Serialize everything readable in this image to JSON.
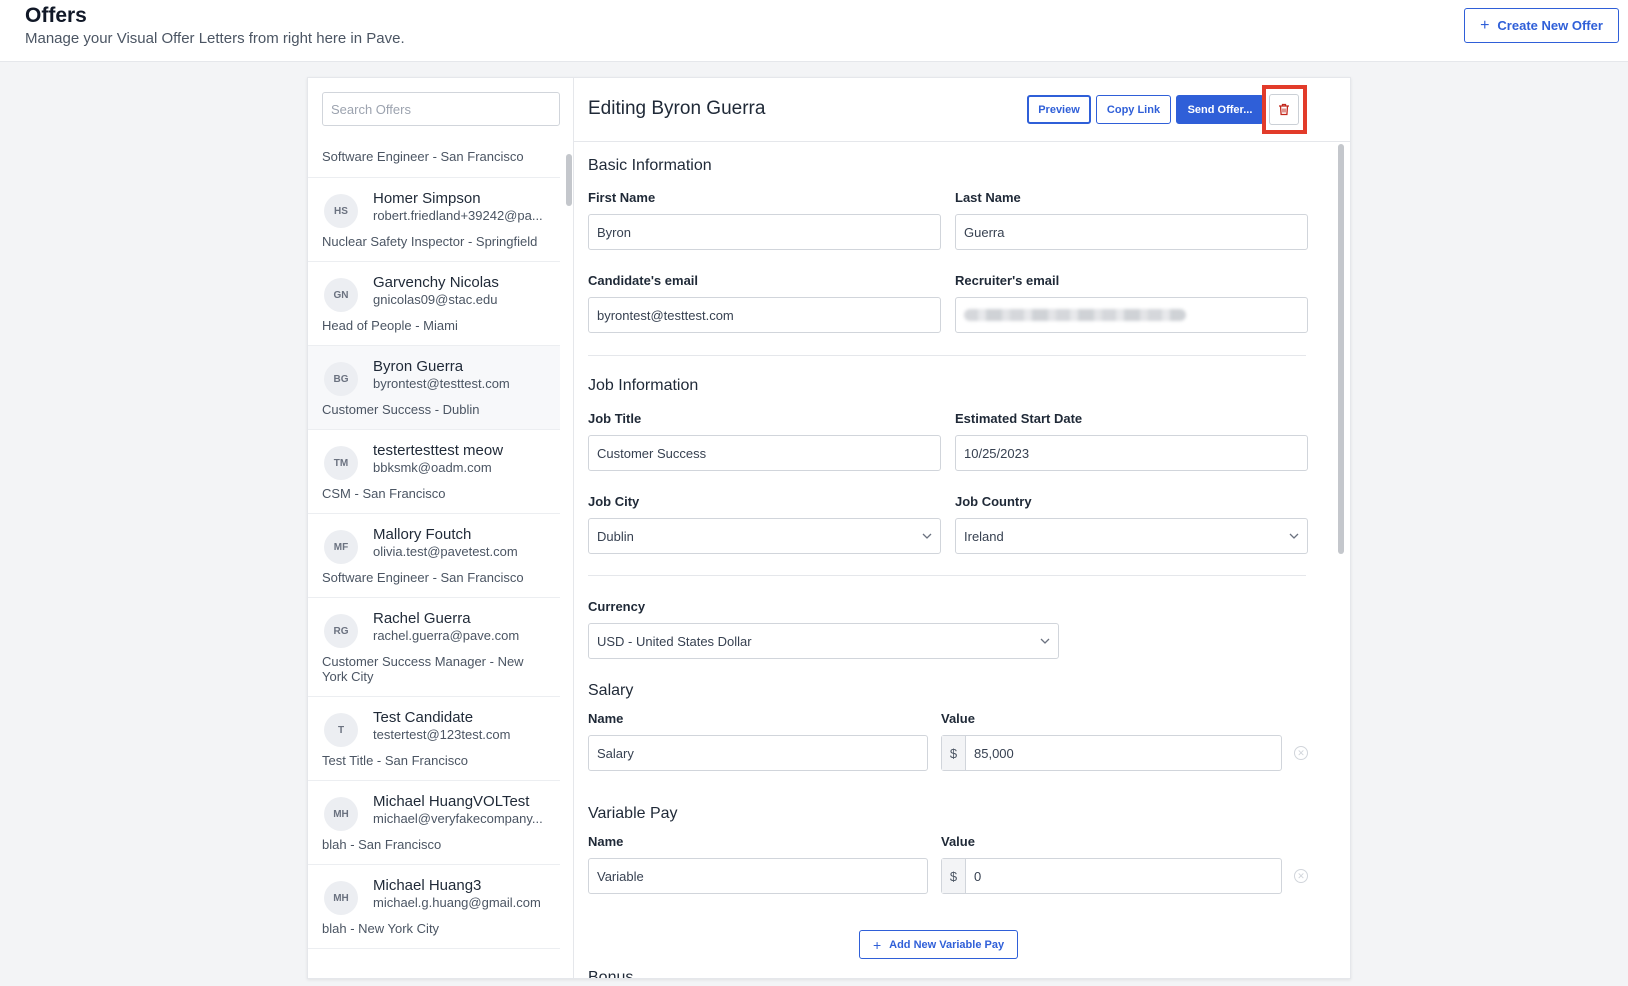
{
  "header": {
    "title": "Offers",
    "subtitle": "Manage your Visual Offer Letters from right here in Pave.",
    "create_button": "Create New Offer"
  },
  "search": {
    "placeholder": "Search Offers"
  },
  "offers_list": {
    "partial_top_role": "Software Engineer - San Francisco",
    "items": [
      {
        "initials": "HS",
        "name": "Homer Simpson",
        "email": "robert.friedland+39242@pa...",
        "role": "Nuclear Safety Inspector - Springfield"
      },
      {
        "initials": "GN",
        "name": "Garvenchy Nicolas",
        "email": "gnicolas09@stac.edu",
        "role": "Head of People - Miami"
      },
      {
        "initials": "BG",
        "name": "Byron Guerra",
        "email": "byrontest@testtest.com",
        "role": "Customer Success - Dublin"
      },
      {
        "initials": "TM",
        "name": "testertesttest meow",
        "email": "bbksmk@oadm.com",
        "role": "CSM - San Francisco"
      },
      {
        "initials": "MF",
        "name": "Mallory Foutch",
        "email": "olivia.test@pavetest.com",
        "role": "Software Engineer - San Francisco"
      },
      {
        "initials": "RG",
        "name": "Rachel Guerra",
        "email": "rachel.guerra@pave.com",
        "role": "Customer Success Manager - New York City"
      },
      {
        "initials": "T",
        "name": "Test Candidate",
        "email": "testertest@123test.com",
        "role": "Test Title - San Francisco"
      },
      {
        "initials": "MH",
        "name": "Michael HuangVOLTest",
        "email": "michael@veryfakecompany...",
        "role": "blah - San Francisco"
      },
      {
        "initials": "MH",
        "name": "Michael Huang3",
        "email": "michael.g.huang@gmail.com",
        "role": "blah - New York City"
      }
    ]
  },
  "editor": {
    "title": "Editing Byron Guerra",
    "buttons": {
      "preview": "Preview",
      "copy_link": "Copy Link",
      "send_offer": "Send Offer..."
    },
    "basic_info": {
      "title": "Basic Information",
      "first_name_label": "First Name",
      "first_name": "Byron",
      "last_name_label": "Last Name",
      "last_name": "Guerra",
      "candidate_email_label": "Candidate's email",
      "candidate_email": "byrontest@testtest.com",
      "recruiter_email_label": "Recruiter's email"
    },
    "job_info": {
      "title": "Job Information",
      "job_title_label": "Job Title",
      "job_title": "Customer Success",
      "start_date_label": "Estimated Start Date",
      "start_date": "10/25/2023",
      "city_label": "Job City",
      "city": "Dublin",
      "country_label": "Job Country",
      "country": "Ireland"
    },
    "currency": {
      "label": "Currency",
      "value": "USD - United States Dollar"
    },
    "salary": {
      "title": "Salary",
      "name_label": "Name",
      "value_label": "Value",
      "name": "Salary",
      "currency_symbol": "$",
      "value": "85,000"
    },
    "variable_pay": {
      "title": "Variable Pay",
      "name_label": "Name",
      "value_label": "Value",
      "name": "Variable",
      "currency_symbol": "$",
      "value": "0",
      "add_button": "Add New Variable Pay"
    },
    "next_section_partial": "Bonus"
  },
  "colors": {
    "accent": "#2f5fd8",
    "highlight": "#e23b2a"
  },
  "icons": [
    "plus-icon",
    "trash-icon",
    "chevron-down-icon",
    "remove-circle-icon"
  ]
}
